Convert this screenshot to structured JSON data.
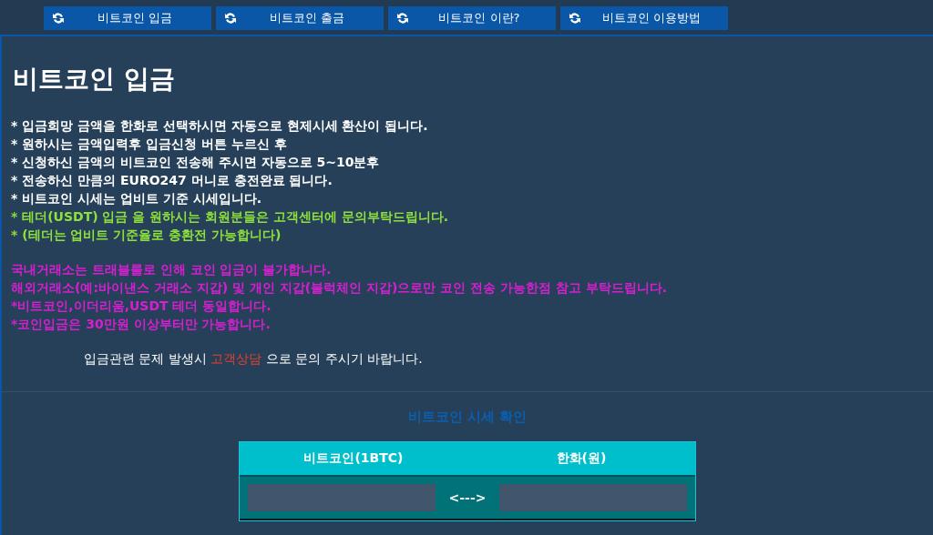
{
  "nav": [
    {
      "label": "비트코인 입금"
    },
    {
      "label": "비트코인 출금"
    },
    {
      "label": "비트코인 이란?"
    },
    {
      "label": "비트코인 이용방법"
    }
  ],
  "title": "비트코인 입금",
  "notes": [
    {
      "text": "* 입금희망 금액을 한화로 선택하시면 자동으로 현제시세 환산이 됩니다.",
      "kind": "info"
    },
    {
      "text": "* 원하시는 금액입력후 입금신청 버튼 누르신 후",
      "kind": "info"
    },
    {
      "text": "* 신청하신 금액의 비트코인 전송해 주시면 자동으로 5~10분후",
      "kind": "info"
    },
    {
      "text": "* 전송하신 만큼의 EURO247 머니로 충전완료 됩니다.",
      "kind": "info"
    },
    {
      "text": "* 비트코인 시세는 업비트 기준 시세입니다.",
      "kind": "info"
    },
    {
      "text": "* 테더(USDT) 입금 을 원하시는 회원분들은 고객센터에 문의부탁드립니다.",
      "kind": "tip"
    },
    {
      "text": "* (테더는 업비트 기준율로 충환전 가능합니다)",
      "kind": "tip"
    }
  ],
  "warnings": [
    {
      "text": "국내거래소는 트래블룰로 인해 코인 입금이 불가합니다.",
      "kind": "warning"
    },
    {
      "text": "해외거래소(예:바이낸스 거래소 지갑) 및 개인 지갑(블럭체인 지갑)으로만 코인 전송 가능한점 참고 부탁드립니다.",
      "kind": "warning"
    },
    {
      "text": "*비트코인,이더리움,USDT 테더 동일합니다.",
      "kind": "warning"
    },
    {
      "text": "*코인입금은 30만원 이상부터만 가능합니다.",
      "kind": "warning"
    }
  ],
  "contact": {
    "before": "입금관련 문제 발생시",
    "link": "고객상담",
    "after": "으로 문의 주시기 바랍니다."
  },
  "converter": {
    "title": "비트코인 시세 확인",
    "columns": [
      "비트코인(1BTC)",
      "한화(원)"
    ],
    "arrow": "<--->"
  }
}
